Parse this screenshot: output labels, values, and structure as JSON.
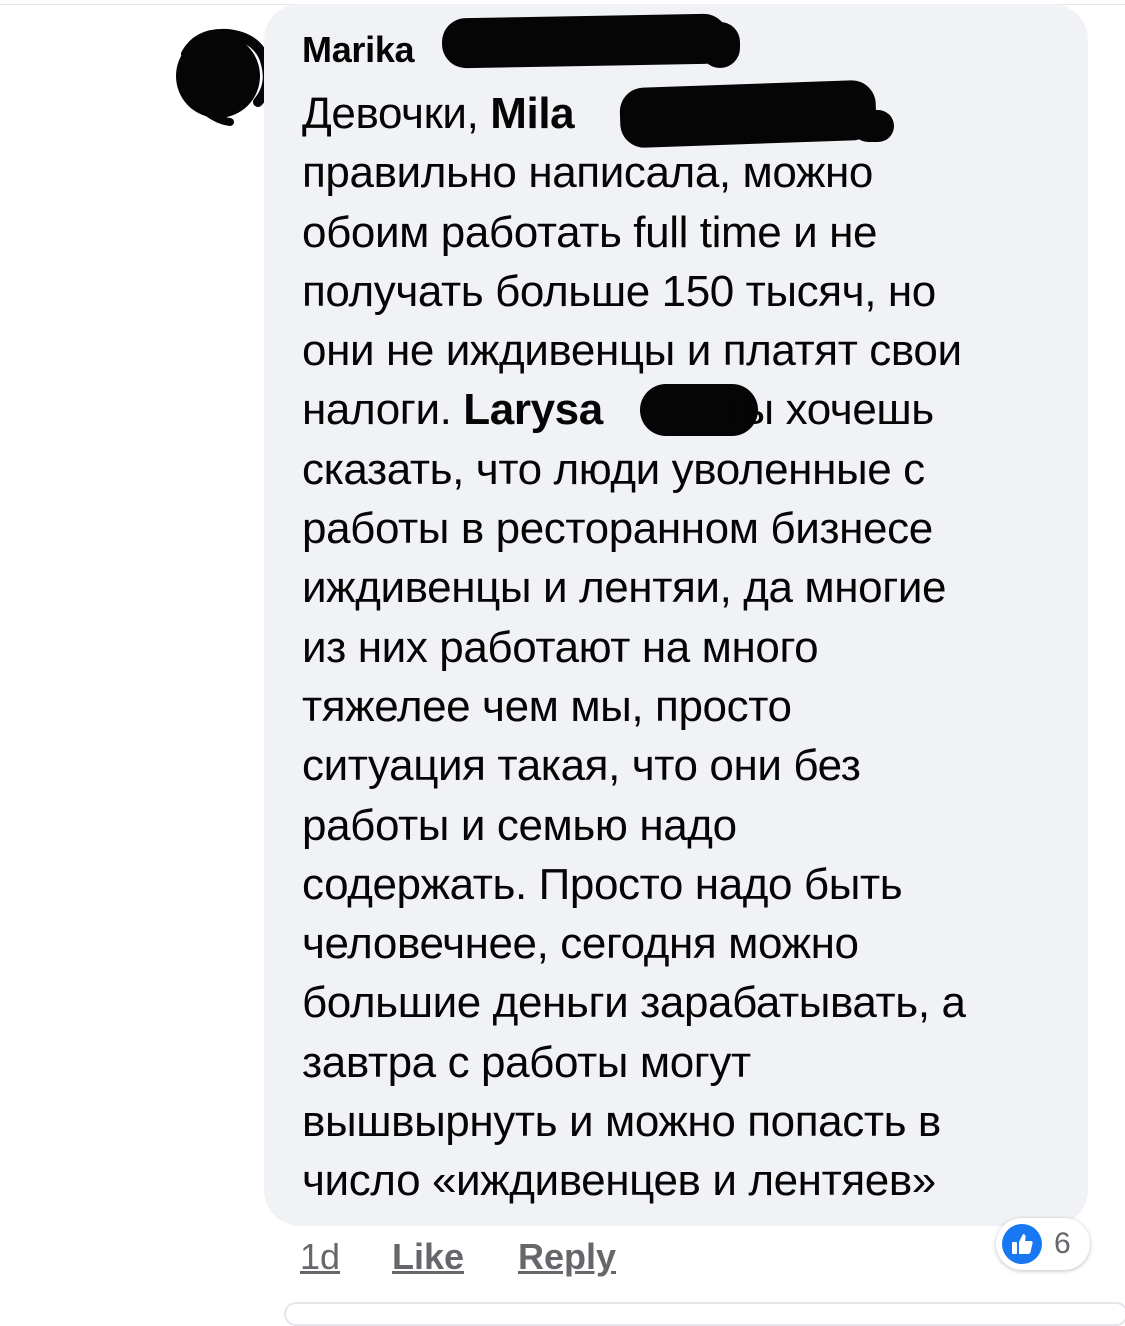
{
  "comment": {
    "author_name": "Marika",
    "lines": [
      {
        "before": "Девочки, ",
        "mention": "Mila",
        "after": ""
      },
      {
        "text": "правильно написала, можно"
      },
      {
        "text": "обоим работать full time и не"
      },
      {
        "text": "получать больше 150 тысяч, но"
      },
      {
        "text": "они не иждивенцы и платят свои"
      },
      {
        "before": "налоги. ",
        "mention": "Larysa",
        "after": "ты хочешь"
      },
      {
        "text": "сказать, что люди уволенные с"
      },
      {
        "text": "работы в ресторанном бизнесе"
      },
      {
        "text": "иждивенцы и лентяи, да многие"
      },
      {
        "text": "из них работают на много"
      },
      {
        "text": "тяжелее чем мы, просто"
      },
      {
        "text": "ситуация такая, что они без"
      },
      {
        "text": "работы и семью надо"
      },
      {
        "text": "содержать. Просто надо быть"
      },
      {
        "text": "человечнее, сегодня можно"
      },
      {
        "text": "большие деньги зарабатывать, а"
      },
      {
        "text": "завтра с работы могут"
      },
      {
        "text": "вышвырнуть и можно попасть в"
      },
      {
        "text": "число «иждивенцев и лентяев»"
      }
    ]
  },
  "actions": {
    "time": "1d",
    "like_label": "Like",
    "reply_label": "Reply"
  },
  "reactions": {
    "icon": "thumbs-up-icon",
    "count": "6"
  },
  "colors": {
    "bubble": "#f0f2f5",
    "text": "#050505",
    "muted": "#65676b",
    "like_blue": "#1877f2",
    "redaction": "#050505"
  }
}
